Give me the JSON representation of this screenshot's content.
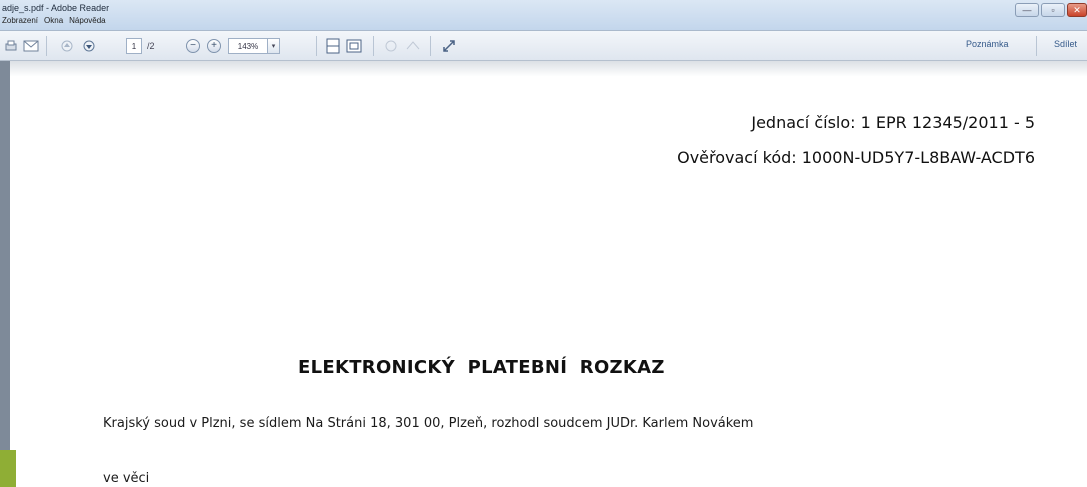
{
  "window": {
    "title": "adje_s.pdf - Adobe Reader",
    "menu": [
      "Zobrazení",
      "Okna",
      "Nápověda"
    ],
    "controls": [
      "—",
      "▫",
      "✕"
    ]
  },
  "toolbar": {
    "page_current": "1",
    "page_total": "/2",
    "zoom": "143%",
    "right_buttons": [
      "Poznámka",
      "Sdílet"
    ]
  },
  "document": {
    "ref_label": "Jednací číslo:",
    "ref_value": "1 EPR 12345/2011 - 5",
    "code_label": "Ověřovací kód:",
    "code_value": "1000N-UD5Y7-L8BAW-ACDT6",
    "heading": "ELEKTRONICKÝ PLATEBNÍ ROZKAZ",
    "paragraph1": "Krajský soud v Plzni, se sídlem Na Stráni 18, 301 00, Plzeň, rozhodl soudcem JUDr. Karlem Novákem",
    "paragraph2": "ve věci"
  },
  "colors": {
    "titlebar": "#c3d6ec",
    "accent_green": "#8fae35",
    "link_blue": "#355a8a"
  }
}
